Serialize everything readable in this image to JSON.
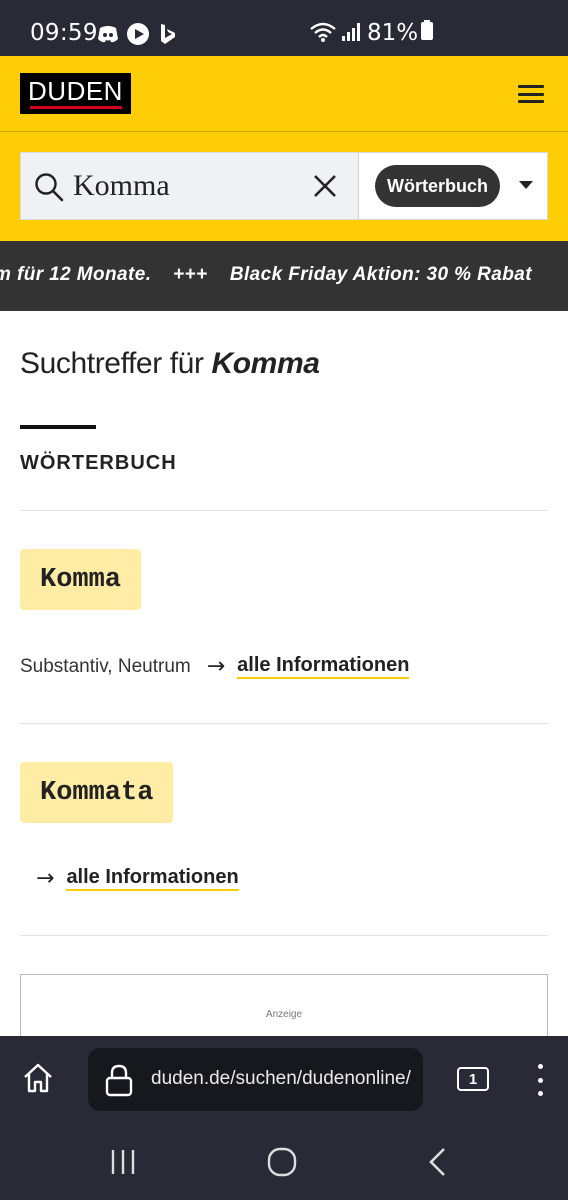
{
  "status_bar": {
    "time": "09:59",
    "battery": "81%"
  },
  "header": {
    "logo_text": "DUDEN"
  },
  "search": {
    "value": "Komma",
    "dictionary_label": "Wörterbuch"
  },
  "ticker": {
    "text_1": "m für 12 Monate.",
    "separator": "+++",
    "text_2": "Black Friday Aktion: 30 % Rabat"
  },
  "main": {
    "title_prefix": "Suchtreffer für ",
    "title_query": "Komma",
    "section_label": "WÖRTERBUCH",
    "results": [
      {
        "word": "Komma",
        "meta": "Substantiv, Neutrum",
        "link": "alle Informationen"
      },
      {
        "word": "Kommata",
        "meta": "",
        "link": "alle Informationen"
      }
    ],
    "ad_label": "Anzeige"
  },
  "browser": {
    "url": "duden.de/suchen/dudenonline/",
    "tab_count": "1"
  },
  "colors": {
    "brand_yellow": "#ffcd05",
    "chip_yellow": "#ffeda6",
    "dark": "#333333",
    "system_bar": "#282a35"
  }
}
